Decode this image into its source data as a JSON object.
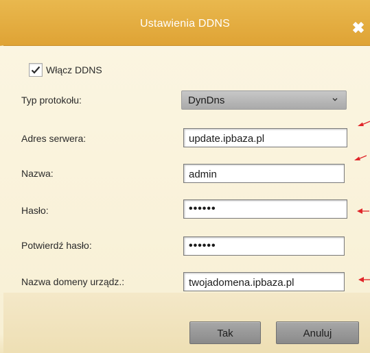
{
  "dialog": {
    "title": "Ustawienia DDNS"
  },
  "enable": {
    "label": "Włącz DDNS",
    "checked": true
  },
  "form": {
    "protocol_label": "Typ protokołu:",
    "protocol_value": "DynDns",
    "server_label": "Adres serwera:",
    "server_value": "update.ipbaza.pl",
    "name_label": "Nazwa:",
    "name_value": "admin",
    "password_label": "Hasło:",
    "password_value": "••••••",
    "confirm_label": "Potwierdź hasło:",
    "confirm_value": "••••••",
    "domain_label": "Nazwa domeny urządz.:",
    "domain_value": "twojadomena.ipbaza.pl"
  },
  "buttons": {
    "ok": "Tak",
    "cancel": "Anuluj"
  },
  "colors": {
    "titlebar": "#e0a63a",
    "annotation_arrow": "#e0262a"
  },
  "icons": {
    "close": "close-icon",
    "check": "check-icon",
    "dropdown": "chevron-down-icon",
    "annotation": "arrow-icon"
  }
}
